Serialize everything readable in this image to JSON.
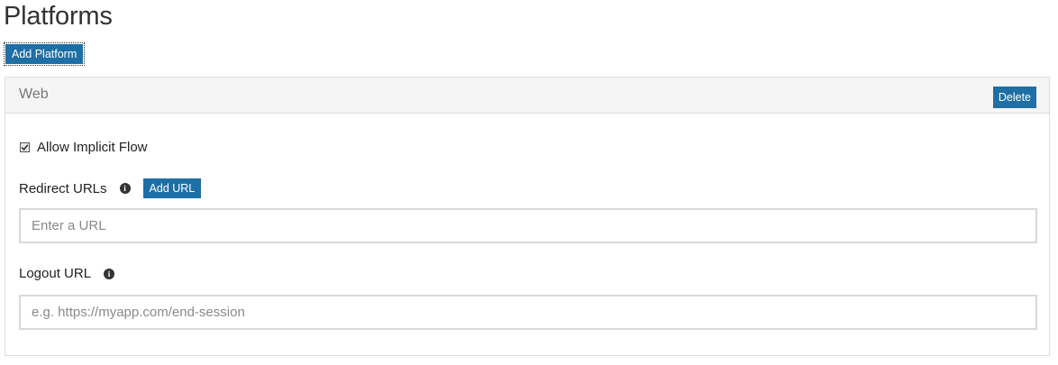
{
  "page": {
    "title": "Platforms",
    "add_platform_label": "Add Platform"
  },
  "panel": {
    "title": "Web",
    "delete_label": "Delete",
    "allow_implicit_flow": {
      "label": "Allow Implicit Flow",
      "checked": true
    },
    "redirect_urls": {
      "label": "Redirect URLs",
      "add_url_label": "Add URL",
      "input_value": "",
      "placeholder": "Enter a URL"
    },
    "logout_url": {
      "label": "Logout URL",
      "input_value": "",
      "placeholder": "e.g. https://myapp.com/end-session"
    }
  },
  "icons": {
    "info": "info-icon",
    "checkmark": "checkmark-icon"
  },
  "colors": {
    "primary_button": "#1e6fa5",
    "panel_header_bg": "#f5f5f5",
    "border": "#dcdcdc"
  }
}
